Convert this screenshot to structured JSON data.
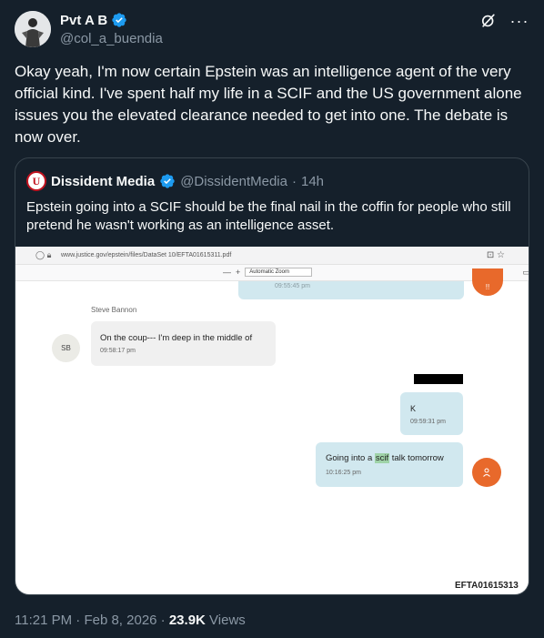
{
  "author": {
    "name": "Pvt A B",
    "handle": "@col_a_buendia"
  },
  "post": {
    "text": "Okay yeah, I'm now certain Epstein was an intelligence agent of the very official kind. I've spent half my life in a SCIF and the US government alone issues you the elevated clearance needed to get into one. The debate is now over."
  },
  "quote": {
    "name": "Dissident Media",
    "handle": "@DissidentMedia",
    "separator": "·",
    "time": "14h",
    "text": "Epstein going into a SCIF should be the final nail in the coffin for people who still pretend he wasn't working as an intelligence asset.",
    "screenshot": {
      "url": "www.justice.gov/epstein/files/DataSet 10/EFTA01615311.pdf",
      "zoom_minus": "—",
      "zoom_plus": "+",
      "zoom_label": "Automatic Zoom",
      "top_bubble_time": "09:55:45 pm",
      "sender": "Steve Bannon",
      "sender_initials": "SB",
      "incoming_message": "On the coup--- I'm deep in the middle of",
      "incoming_time": "09:58:17 pm",
      "reply_k": "K",
      "reply_k_time": "09:59:31 pm",
      "scif_message_before": "Going into a ",
      "scif_message_highlight": "scif",
      "scif_message_after": " talk tomorrow",
      "scif_time": "10:16:25 pm",
      "doc_id": "EFTA01615313"
    }
  },
  "meta": {
    "time": "11:21 PM",
    "separator": "·",
    "date": "Feb 8, 2026",
    "views_count": "23.9K",
    "views_label": "Views"
  },
  "colors": {
    "background": "#15202b",
    "verified": "#1d9bf0",
    "muted": "#8b98a5",
    "bubble_blue": "#d1e8ef",
    "accent_orange": "#e8692b"
  }
}
